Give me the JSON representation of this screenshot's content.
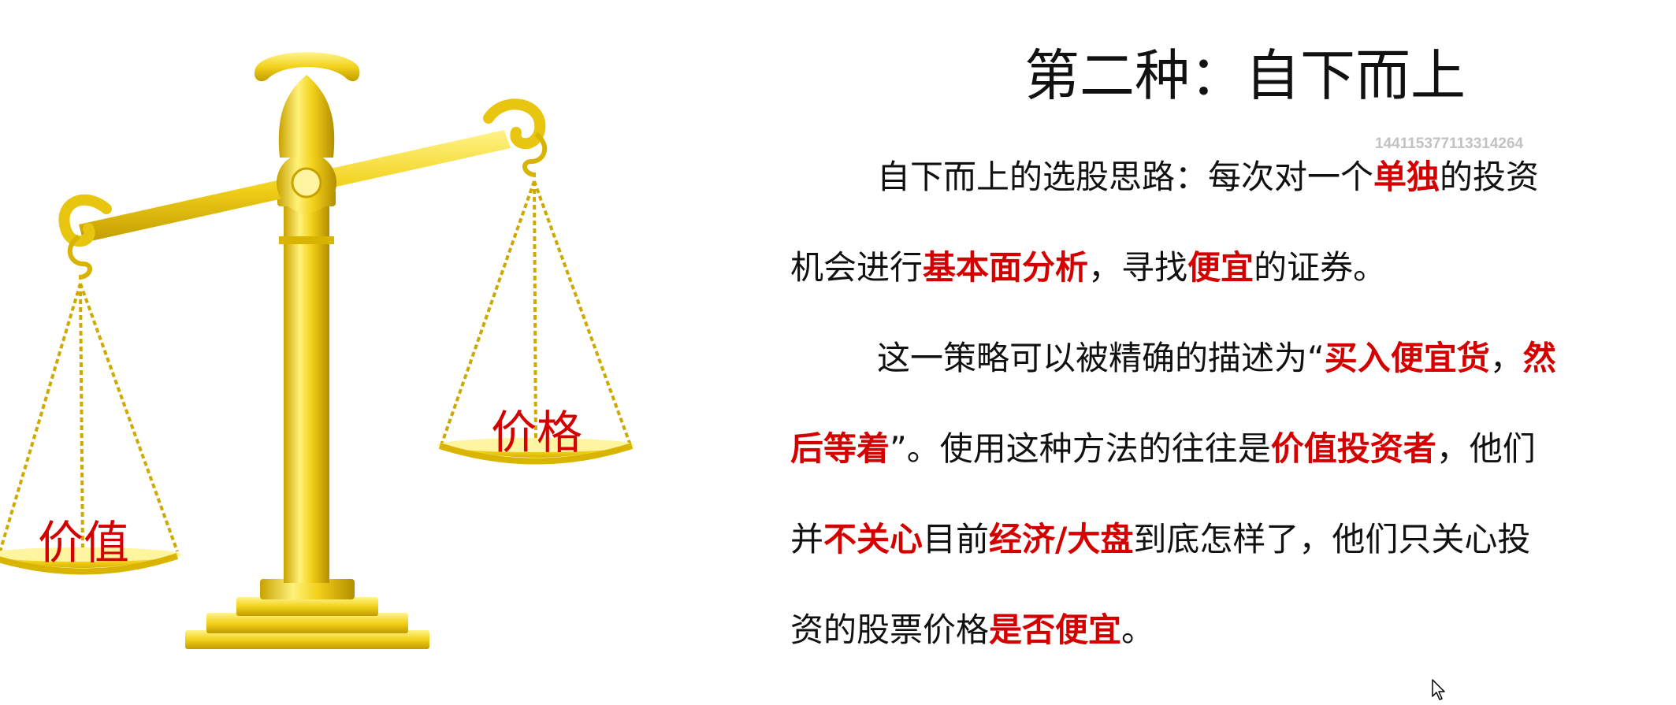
{
  "slide": {
    "title": "第二种：自下而上",
    "watermark": "1441153771133142​64",
    "scale_labels": {
      "right_pan": "价格",
      "left_pan": "价值"
    },
    "paragraphs": [
      {
        "lines": [
          [
            {
              "t": "自下而上的选股思路：每次对一个"
            },
            {
              "t": "单独",
              "hl": true
            },
            {
              "t": "的投资"
            }
          ],
          [
            {
              "t": "机会进行"
            },
            {
              "t": "基本面分析",
              "hl": true
            },
            {
              "t": "，寻找"
            },
            {
              "t": "便宜",
              "hl": true
            },
            {
              "t": "的证券。"
            }
          ]
        ]
      },
      {
        "lines": [
          [
            {
              "t": "这一策略可以被精确的描述为“"
            },
            {
              "t": "买入便宜货",
              "hl": true
            },
            {
              "t": "，"
            },
            {
              "t": "然",
              "hl": true
            }
          ],
          [
            {
              "t": "后等着",
              "hl": true
            },
            {
              "t": "”。使用这种方法的往往是"
            },
            {
              "t": "价值投资者",
              "hl": true
            },
            {
              "t": "，他们"
            }
          ],
          [
            {
              "t": "并"
            },
            {
              "t": "不关心",
              "hl": true
            },
            {
              "t": "目前"
            },
            {
              "t": "经济/大盘",
              "hl": true
            },
            {
              "t": "到底怎样了，他们只关心投"
            }
          ],
          [
            {
              "t": "资的股票价格"
            },
            {
              "t": "是否便宜",
              "hl": true
            },
            {
              "t": "。"
            }
          ]
        ]
      }
    ]
  },
  "colors": {
    "highlight": "#d40000",
    "text": "#111111",
    "gold": "#f2d21b",
    "watermark": "#c2c2c2"
  },
  "icons": {
    "scale": "balance-scale-icon",
    "cursor": "mouse-pointer-icon"
  }
}
